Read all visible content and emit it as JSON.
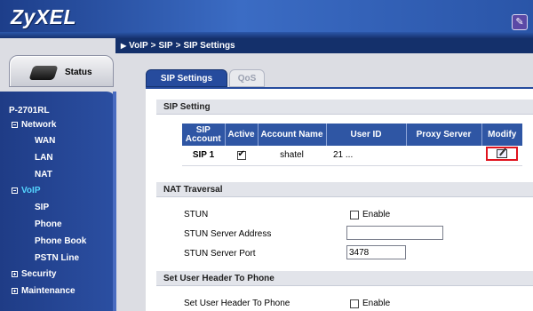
{
  "brand": {
    "logo": "ZyXEL"
  },
  "breadcrumb": {
    "parts": [
      "VoIP",
      "SIP",
      "SIP Settings"
    ]
  },
  "sidebar": {
    "status_label": "Status",
    "device": "P-2701RL",
    "groups": [
      {
        "label": "Network",
        "expanded": true,
        "items": [
          "WAN",
          "LAN",
          "NAT"
        ]
      },
      {
        "label": "VoIP",
        "expanded": true,
        "active": true,
        "items": [
          "SIP",
          "Phone",
          "Phone Book",
          "PSTN Line"
        ]
      },
      {
        "label": "Security",
        "expanded": false,
        "items": []
      },
      {
        "label": "Maintenance",
        "expanded": false,
        "items": []
      }
    ]
  },
  "tabs": {
    "active": "SIP Settings",
    "inactive": "QoS"
  },
  "sip_setting": {
    "title": "SIP Setting",
    "headers": [
      "SIP Account",
      "Active",
      "Account Name",
      "User ID",
      "Proxy Server",
      "Modify"
    ],
    "rows": [
      {
        "account": "SIP 1",
        "active": true,
        "name": "shatel",
        "user_id": "21 ...",
        "proxy": ""
      }
    ]
  },
  "nat": {
    "title": "NAT Traversal",
    "stun_label": "STUN",
    "stun_enable_label": "Enable",
    "stun_enabled": false,
    "server_address_label": "STUN Server Address",
    "server_address_value": "",
    "server_port_label": "STUN Server Port",
    "server_port_value": "3478"
  },
  "user_header": {
    "title": "Set User Header To Phone",
    "label": "Set User Header To Phone",
    "enable_label": "Enable",
    "enabled": false
  },
  "colors": {
    "nav_blue": "#1f3c86",
    "header_blue": "#2f56a4",
    "highlight": "#e0131e",
    "active_group": "#54d4ff"
  }
}
